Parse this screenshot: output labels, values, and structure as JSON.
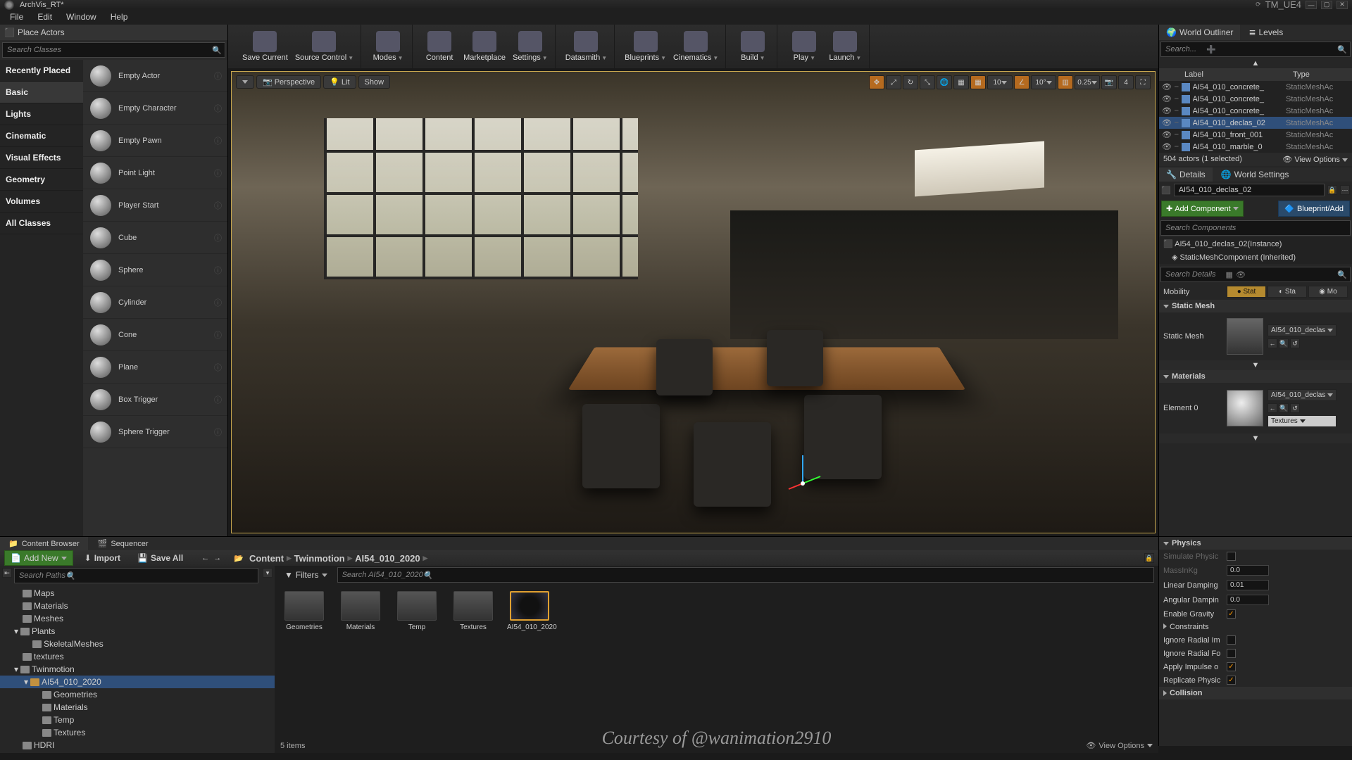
{
  "title": "ArchVis_RT*",
  "project": "TM_UE4",
  "menu": [
    "File",
    "Edit",
    "Window",
    "Help"
  ],
  "placeActors": {
    "tab": "Place Actors",
    "searchPlaceholder": "Search Classes",
    "categories": [
      "Recently Placed",
      "Basic",
      "Lights",
      "Cinematic",
      "Visual Effects",
      "Geometry",
      "Volumes",
      "All Classes"
    ],
    "selectedCategory": "Basic",
    "actors": [
      "Empty Actor",
      "Empty Character",
      "Empty Pawn",
      "Point Light",
      "Player Start",
      "Cube",
      "Sphere",
      "Cylinder",
      "Cone",
      "Plane",
      "Box Trigger",
      "Sphere Trigger"
    ]
  },
  "toolbar": [
    {
      "label": "Save Current"
    },
    {
      "label": "Source Control",
      "drop": true
    },
    {
      "label": "Modes",
      "drop": true
    },
    {
      "label": "Content"
    },
    {
      "label": "Marketplace"
    },
    {
      "label": "Settings",
      "drop": true
    },
    {
      "label": "Datasmith",
      "drop": true
    },
    {
      "label": "Blueprints",
      "drop": true
    },
    {
      "label": "Cinematics",
      "drop": true
    },
    {
      "label": "Build",
      "drop": true
    },
    {
      "label": "Play",
      "drop": true
    },
    {
      "label": "Launch",
      "drop": true
    }
  ],
  "viewportButtons": {
    "perspective": "Perspective",
    "lit": "Lit",
    "show": "Show"
  },
  "viewportValues": {
    "speed": "10",
    "angle": "10°",
    "snap": "0.25",
    "cam": "4"
  },
  "outliner": {
    "tab1": "World Outliner",
    "tab2": "Levels",
    "searchPlaceholder": "Search...",
    "colLabel": "Label",
    "colType": "Type",
    "rows": [
      {
        "name": "AI54_010_concrete_",
        "type": "StaticMeshAc"
      },
      {
        "name": "AI54_010_concrete_",
        "type": "StaticMeshAc"
      },
      {
        "name": "AI54_010_concrete_",
        "type": "StaticMeshAc"
      },
      {
        "name": "AI54_010_declas_02",
        "type": "StaticMeshAc",
        "sel": true
      },
      {
        "name": "AI54_010_front_001",
        "type": "StaticMeshAc"
      },
      {
        "name": "AI54_010_marble_0",
        "type": "StaticMeshAc"
      }
    ],
    "footer": "504 actors (1 selected)",
    "viewOptions": "View Options"
  },
  "details": {
    "tab1": "Details",
    "tab2": "World Settings",
    "actorName": "AI54_010_declas_02",
    "addComponent": "Add Component",
    "bpAdd": "Blueprint/Add",
    "searchComponents": "Search Components",
    "instance": "AI54_010_declas_02(Instance)",
    "smc": "StaticMeshComponent (Inherited)",
    "searchDetails": "Search Details",
    "mobilityLabel": "Mobility",
    "mobility": [
      "Stat",
      "Sta",
      "Mo"
    ],
    "secStaticMesh": "Static Mesh",
    "staticMeshLabel": "Static Mesh",
    "staticMeshAsset": "AI54_010_declas",
    "secMaterials": "Materials",
    "element0": "Element 0",
    "materialAsset": "AI54_010_declas",
    "texturesLabel": "Textures",
    "secPhysics": "Physics",
    "physics": [
      {
        "label": "Simulate Physic",
        "type": "check",
        "val": false,
        "dis": true
      },
      {
        "label": "MassInKg",
        "type": "num",
        "val": "0.0",
        "dis": true
      },
      {
        "label": "Linear Damping",
        "type": "num",
        "val": "0.01"
      },
      {
        "label": "Angular Dampin",
        "type": "num",
        "val": "0.0"
      },
      {
        "label": "Enable Gravity",
        "type": "check",
        "val": true
      },
      {
        "label": "Constraints",
        "type": "expand"
      },
      {
        "label": "Ignore Radial Im",
        "type": "check",
        "val": false
      },
      {
        "label": "Ignore Radial Fo",
        "type": "check",
        "val": false
      },
      {
        "label": "Apply Impulse o",
        "type": "check",
        "val": true
      },
      {
        "label": "Replicate Physic",
        "type": "check",
        "val": true
      }
    ],
    "secCollision": "Collision"
  },
  "contentBrowser": {
    "tab1": "Content Browser",
    "tab2": "Sequencer",
    "addNew": "Add New",
    "import": "Import",
    "saveAll": "Save All",
    "breadcrumb": [
      "Content",
      "Twinmotion",
      "AI54_010_2020"
    ],
    "treeSearch": "Search Paths",
    "tree": [
      {
        "name": "Maps",
        "depth": 1
      },
      {
        "name": "Materials",
        "depth": 1
      },
      {
        "name": "Meshes",
        "depth": 1
      },
      {
        "name": "Plants",
        "depth": 1,
        "exp": true
      },
      {
        "name": "SkeletalMeshes",
        "depth": 2
      },
      {
        "name": "textures",
        "depth": 1
      },
      {
        "name": "Twinmotion",
        "depth": 1,
        "exp": true,
        "sel": false
      },
      {
        "name": "AI54_010_2020",
        "depth": 2,
        "sel": true,
        "exp": true
      },
      {
        "name": "Geometries",
        "depth": 3
      },
      {
        "name": "Materials",
        "depth": 3
      },
      {
        "name": "Temp",
        "depth": 3
      },
      {
        "name": "Textures",
        "depth": 3
      },
      {
        "name": "HDRI",
        "depth": 1
      }
    ],
    "filters": "Filters",
    "gridSearch": "Search AI54_010_2020",
    "assets": [
      {
        "name": "Geometries"
      },
      {
        "name": "Materials"
      },
      {
        "name": "Temp"
      },
      {
        "name": "Textures"
      },
      {
        "name": "AI54_010_2020",
        "sel": true
      }
    ],
    "itemCount": "5 items",
    "viewOptions": "View Options"
  },
  "courtesy": "Courtesy of @wanimation2910"
}
